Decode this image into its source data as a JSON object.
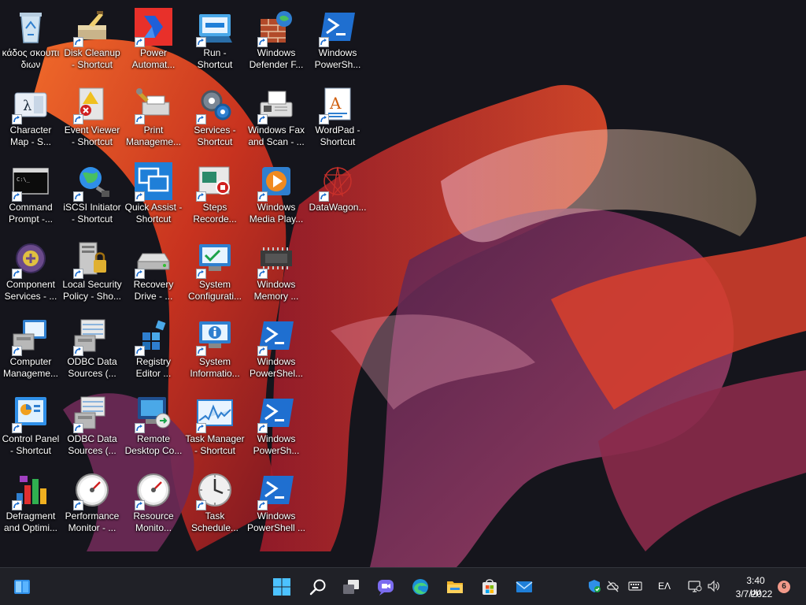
{
  "colors": {
    "taskbar_bg": "#202127",
    "wallpaper_dark": "#15151c",
    "wallpaper_orange": "#e2501e",
    "wallpaper_red": "#b3202c",
    "wallpaper_purple": "#6a2a56"
  },
  "desktop_icons": [
    {
      "label": "κάδος σκουπι\nδιων",
      "icon": "recycle-bin-icon",
      "shortcut": false,
      "col": 0,
      "row": 0
    },
    {
      "label": "Disk Cleanup\n- Shortcut",
      "icon": "disk-cleanup-icon",
      "shortcut": true,
      "col": 1,
      "row": 0
    },
    {
      "label": "Power\nAutomat...",
      "icon": "power-automate-icon",
      "shortcut": true,
      "col": 2,
      "row": 0
    },
    {
      "label": "Run -\nShortcut",
      "icon": "run-icon",
      "shortcut": true,
      "col": 3,
      "row": 0
    },
    {
      "label": "Windows\nDefender F...",
      "icon": "firewall-icon",
      "shortcut": true,
      "col": 4,
      "row": 0
    },
    {
      "label": "Windows\nPowerSh...",
      "icon": "powershell-icon",
      "shortcut": true,
      "col": 5,
      "row": 0
    },
    {
      "label": "Character\nMap - S...",
      "icon": "character-map-icon",
      "shortcut": true,
      "col": 0,
      "row": 1
    },
    {
      "label": "Event Viewer\n- Shortcut",
      "icon": "event-viewer-icon",
      "shortcut": true,
      "col": 1,
      "row": 1
    },
    {
      "label": "Print\nManageme...",
      "icon": "print-management-icon",
      "shortcut": true,
      "col": 2,
      "row": 1
    },
    {
      "label": "Services -\nShortcut",
      "icon": "services-gear-icon",
      "shortcut": true,
      "col": 3,
      "row": 1
    },
    {
      "label": "Windows Fax\nand Scan - ...",
      "icon": "fax-icon",
      "shortcut": true,
      "col": 4,
      "row": 1
    },
    {
      "label": "WordPad -\nShortcut",
      "icon": "wordpad-icon",
      "shortcut": true,
      "col": 5,
      "row": 1
    },
    {
      "label": "Command\nPrompt -...",
      "icon": "command-prompt-icon",
      "shortcut": true,
      "col": 0,
      "row": 2
    },
    {
      "label": "iSCSI Initiator\n- Shortcut",
      "icon": "iscsi-globe-icon",
      "shortcut": true,
      "col": 1,
      "row": 2
    },
    {
      "label": "Quick Assist -\nShortcut",
      "icon": "quick-assist-icon",
      "shortcut": true,
      "col": 2,
      "row": 2
    },
    {
      "label": "Steps\nRecorde...",
      "icon": "steps-recorder-icon",
      "shortcut": true,
      "col": 3,
      "row": 2
    },
    {
      "label": "Windows\nMedia Play...",
      "icon": "media-player-icon",
      "shortcut": true,
      "col": 4,
      "row": 2
    },
    {
      "label": "DataWagon...",
      "icon": "datawagon-icon",
      "shortcut": true,
      "col": 5,
      "row": 2
    },
    {
      "label": "Component\nServices - ...",
      "icon": "component-services-icon",
      "shortcut": true,
      "col": 0,
      "row": 3
    },
    {
      "label": "Local Security\nPolicy - Sho...",
      "icon": "local-security-icon",
      "shortcut": true,
      "col": 1,
      "row": 3
    },
    {
      "label": "Recovery\nDrive - ...",
      "icon": "recovery-drive-icon",
      "shortcut": true,
      "col": 2,
      "row": 3
    },
    {
      "label": "System\nConfigurati...",
      "icon": "system-config-icon",
      "shortcut": true,
      "col": 3,
      "row": 3
    },
    {
      "label": "Windows\nMemory ...",
      "icon": "memory-chip-icon",
      "shortcut": true,
      "col": 4,
      "row": 3
    },
    {
      "label": "Computer\nManageme...",
      "icon": "computer-management-icon",
      "shortcut": true,
      "col": 0,
      "row": 4
    },
    {
      "label": "ODBC Data\nSources (...",
      "icon": "odbc-icon",
      "shortcut": true,
      "col": 1,
      "row": 4
    },
    {
      "label": "Registry\nEditor ...",
      "icon": "registry-editor-icon",
      "shortcut": true,
      "col": 2,
      "row": 4
    },
    {
      "label": "System\nInformatio...",
      "icon": "system-info-icon",
      "shortcut": true,
      "col": 3,
      "row": 4
    },
    {
      "label": "Windows\nPowerShel...",
      "icon": "powershell-icon",
      "shortcut": true,
      "col": 4,
      "row": 4
    },
    {
      "label": "Control Panel\n- Shortcut",
      "icon": "control-panel-icon",
      "shortcut": true,
      "col": 0,
      "row": 5
    },
    {
      "label": "ODBC Data\nSources (...",
      "icon": "odbc-icon",
      "shortcut": true,
      "col": 1,
      "row": 5
    },
    {
      "label": "Remote\nDesktop Co...",
      "icon": "remote-desktop-icon",
      "shortcut": true,
      "col": 2,
      "row": 5
    },
    {
      "label": "Task Manager\n- Shortcut",
      "icon": "task-manager-icon",
      "shortcut": true,
      "col": 3,
      "row": 5
    },
    {
      "label": "Windows\nPowerSh...",
      "icon": "powershell-icon",
      "shortcut": true,
      "col": 4,
      "row": 5
    },
    {
      "label": "Defragment\nand Optimi...",
      "icon": "defragment-icon",
      "shortcut": true,
      "col": 0,
      "row": 6
    },
    {
      "label": "Performance\nMonitor - ...",
      "icon": "gauge-icon",
      "shortcut": true,
      "col": 1,
      "row": 6
    },
    {
      "label": "Resource\nMonito...",
      "icon": "gauge-icon",
      "shortcut": true,
      "col": 2,
      "row": 6
    },
    {
      "label": "Task\nSchedule...",
      "icon": "clock-icon",
      "shortcut": true,
      "col": 3,
      "row": 6
    },
    {
      "label": "Windows\nPowerShell ...",
      "icon": "powershell-icon",
      "shortcut": true,
      "col": 4,
      "row": 6
    }
  ],
  "taskbar": {
    "widgets_icon": "widgets-icon",
    "apps": [
      {
        "name": "start",
        "icon": "start-icon"
      },
      {
        "name": "search",
        "icon": "search-icon"
      },
      {
        "name": "task-view",
        "icon": "task-view-icon"
      },
      {
        "name": "chat",
        "icon": "chat-icon"
      },
      {
        "name": "edge",
        "icon": "edge-icon"
      },
      {
        "name": "file-explorer",
        "icon": "folder-icon"
      },
      {
        "name": "store",
        "icon": "store-icon"
      },
      {
        "name": "mail",
        "icon": "mail-icon"
      }
    ],
    "tray": {
      "icons": [
        "security-shield-icon",
        "cloud-off-icon",
        "keyboard-icon",
        "network-icon",
        "volume-icon"
      ],
      "language": "EΛ",
      "time": "3:40 μμ",
      "date": "3/7/2022",
      "notification_count": "6"
    }
  }
}
